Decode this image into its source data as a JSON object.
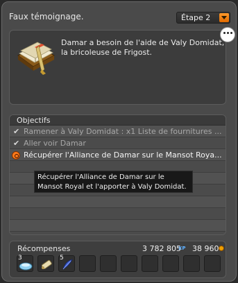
{
  "header": {
    "title": "Faux témoignage.",
    "step_label": "Étape 2"
  },
  "description": {
    "text": "Damar a besoin de l'aide de Valy Domidat, la bricoleuse de Frigost."
  },
  "objectives": {
    "heading": "Objectifs",
    "items": [
      {
        "label": "Ramener à Valy Domidat : x1 Liste de fournitures ...",
        "state": "done"
      },
      {
        "label": "Aller voir Damar",
        "state": "done"
      },
      {
        "label": "Récupérer l'Alliance de Damar sur le Mansot Roya...",
        "state": "active"
      }
    ],
    "tooltip": "Récupérer l'Alliance de Damar sur le Mansot Royal et l'apporter à Valy Domidat."
  },
  "rewards": {
    "label": "Récompenses",
    "xp": "3 782 805",
    "kamas": "38 960",
    "xp_icon": "XP",
    "items": [
      {
        "qty": "3",
        "icon": "ice-pebble-icon"
      },
      {
        "qty": "",
        "icon": "scroll-icon"
      },
      {
        "qty": "5",
        "icon": "feather-icon"
      }
    ]
  },
  "colors": {
    "accent": "#ff8c1a",
    "panel": "#4a4a4a"
  }
}
